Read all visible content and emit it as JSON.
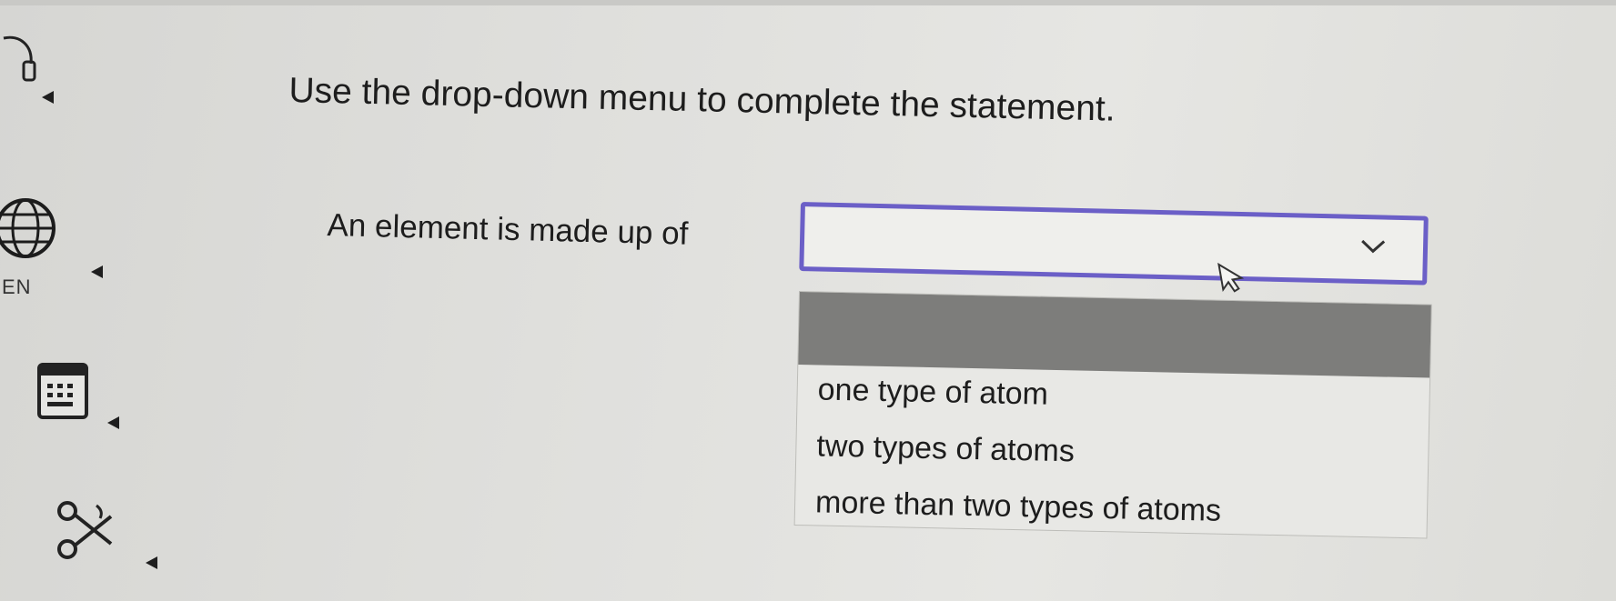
{
  "question": {
    "instruction": "Use the drop-down menu to complete the statement.",
    "statement_prefix": "An element is made up of",
    "dropdown": {
      "selected_value": "",
      "options": [
        "",
        "one type of atom",
        "two types of atoms",
        "more than two types of atoms"
      ]
    }
  },
  "toolbar": {
    "language_label": "EN",
    "tools": [
      "audio-icon",
      "globe-icon",
      "calculator-icon",
      "scissors-icon"
    ]
  },
  "colors": {
    "dropdown_border": "#6b5fc7",
    "highlight_row": "#7d7d7b",
    "background": "#dfdfdc"
  }
}
